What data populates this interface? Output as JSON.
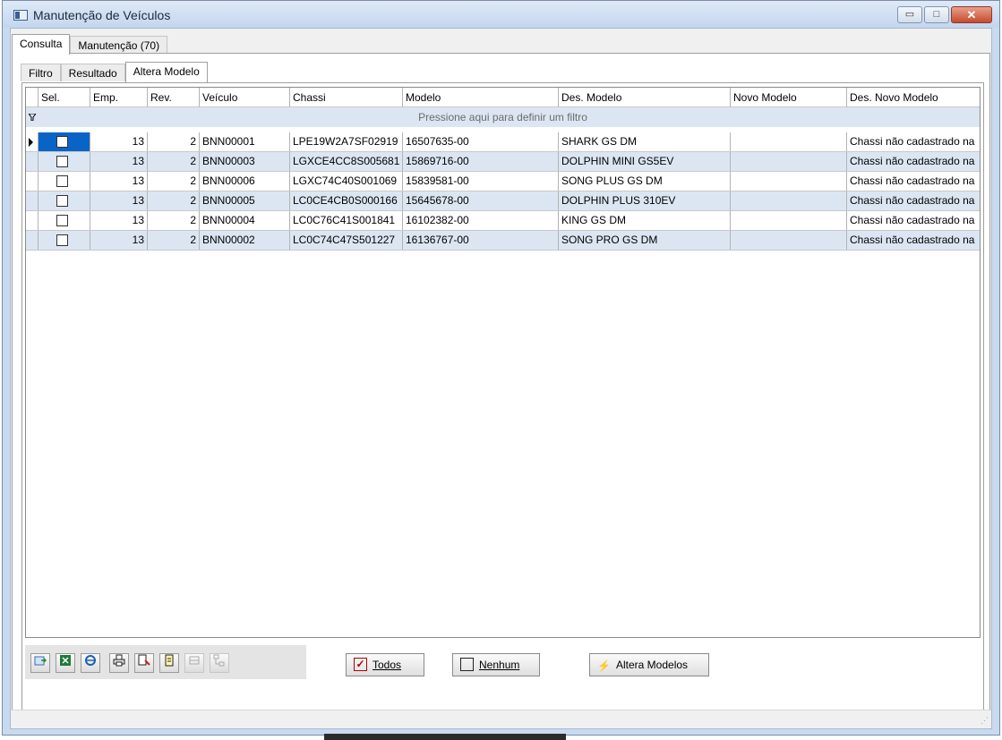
{
  "window": {
    "title": "Manutenção de Veículos",
    "minimize": "▭",
    "maximize": "□",
    "close": "✕"
  },
  "tabs": {
    "top": [
      "Consulta",
      "Manutenção (70)"
    ],
    "sub": [
      "Filtro",
      "Resultado",
      "Altera Modelo"
    ]
  },
  "grid": {
    "columns": [
      "Sel.",
      "Emp.",
      "Rev.",
      "Veículo",
      "Chassi",
      "Modelo",
      "Des. Modelo",
      "Novo Modelo",
      "Des. Novo Modelo"
    ],
    "filter_hint": "Pressione aqui para definir um filtro",
    "rows": [
      {
        "emp": "13",
        "rev": "2",
        "veiculo": "BNN00001",
        "chassi": "LPE19W2A7SF02919",
        "modelo": "16507635-00",
        "des_modelo": "SHARK GS DM",
        "novo_modelo": "",
        "des_novo_modelo": "Chassi não cadastrado na"
      },
      {
        "emp": "13",
        "rev": "2",
        "veiculo": "BNN00003",
        "chassi": "LGXCE4CC8S005681",
        "modelo": "15869716-00",
        "des_modelo": "DOLPHIN MINI GS5EV",
        "novo_modelo": "",
        "des_novo_modelo": "Chassi não cadastrado na"
      },
      {
        "emp": "13",
        "rev": "2",
        "veiculo": "BNN00006",
        "chassi": "LGXC74C40S001069",
        "modelo": "15839581-00",
        "des_modelo": "SONG PLUS GS DM",
        "novo_modelo": "",
        "des_novo_modelo": "Chassi não cadastrado na"
      },
      {
        "emp": "13",
        "rev": "2",
        "veiculo": "BNN00005",
        "chassi": "LC0CE4CB0S000166",
        "modelo": "15645678-00",
        "des_modelo": "DOLPHIN PLUS 310EV",
        "novo_modelo": "",
        "des_novo_modelo": "Chassi não cadastrado na"
      },
      {
        "emp": "13",
        "rev": "2",
        "veiculo": "BNN00004",
        "chassi": "LC0C76C41S001841",
        "modelo": "16102382-00",
        "des_modelo": "KING GS DM",
        "novo_modelo": "",
        "des_novo_modelo": "Chassi não cadastrado na"
      },
      {
        "emp": "13",
        "rev": "2",
        "veiculo": "BNN00002",
        "chassi": "LC0C74C47S501227",
        "modelo": "16136767-00",
        "des_modelo": "SONG PRO GS DM",
        "novo_modelo": "",
        "des_novo_modelo": "Chassi não cadastrado na"
      }
    ]
  },
  "toolbar_icons": [
    "export-icon",
    "excel-icon",
    "browser-icon",
    "print-icon",
    "print-preview-icon",
    "copy-icon",
    "expand-icon",
    "tree-icon"
  ],
  "buttons": {
    "todos": "Todos",
    "nenhum": "Nenhum",
    "altera_modelos": "Altera Modelos"
  },
  "colors": {
    "alt_row": "#dce6f3",
    "selected_cell": "#0a64c8",
    "title_bg": "#c9daf0",
    "close_btn": "#c7492f"
  }
}
